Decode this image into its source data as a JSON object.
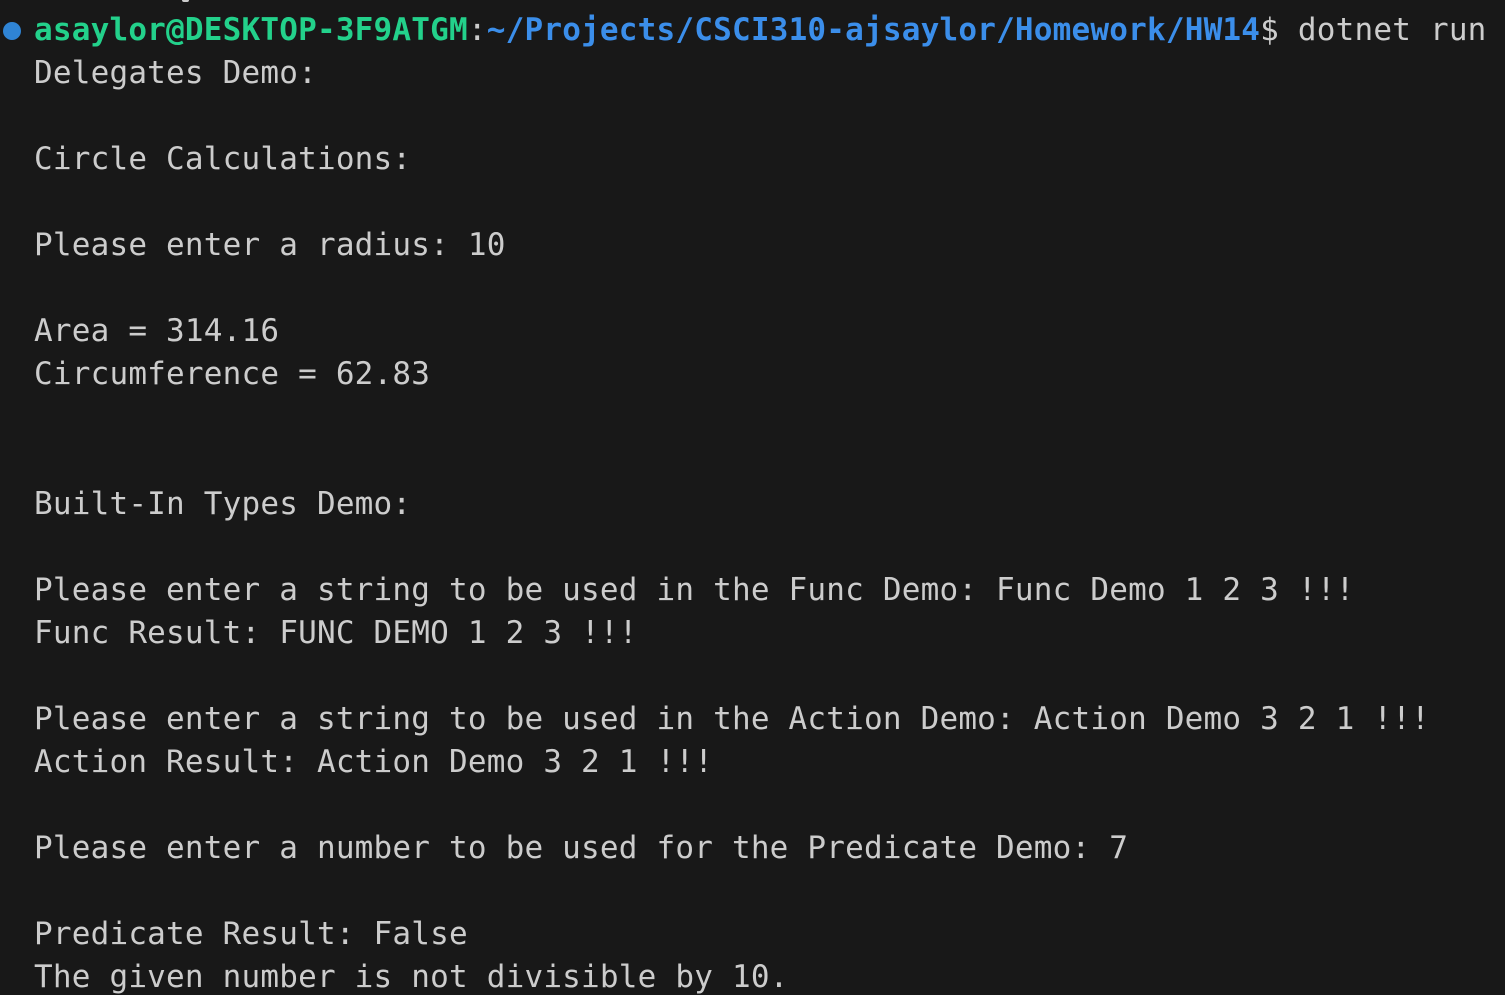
{
  "prompt": {
    "user_host": "asaylor@DESKTOP-3F9ATGM",
    "colon": ":",
    "path": "~/Projects/CSCI310-ajsaylor/Homework/HW14",
    "dollar": "$",
    "command": " dotnet run"
  },
  "status_dot": {
    "color": "#2f84d5"
  },
  "output": {
    "delegates_demo": "Delegates Demo:",
    "circle_calculations": "Circle Calculations:",
    "radius_prompt": "Please enter a radius: 10",
    "area": "Area = 314.16",
    "circumference": "Circumference = 62.83",
    "built_in_types_demo": "Built-In Types Demo:",
    "func_prompt": "Please enter a string to be used in the Func Demo: Func Demo 1 2 3 !!!",
    "func_result": "Func Result: FUNC DEMO 1 2 3 !!!",
    "action_prompt": "Please enter a string to be used in the Action Demo: Action Demo 3 2 1 !!!",
    "action_result": "Action Result: Action Demo 3 2 1 !!!",
    "predicate_prompt": "Please enter a number to be used for the Predicate Demo: 7",
    "predicate_result": "Predicate Result: False",
    "divisible_message": "The given number is not divisible by 10."
  }
}
